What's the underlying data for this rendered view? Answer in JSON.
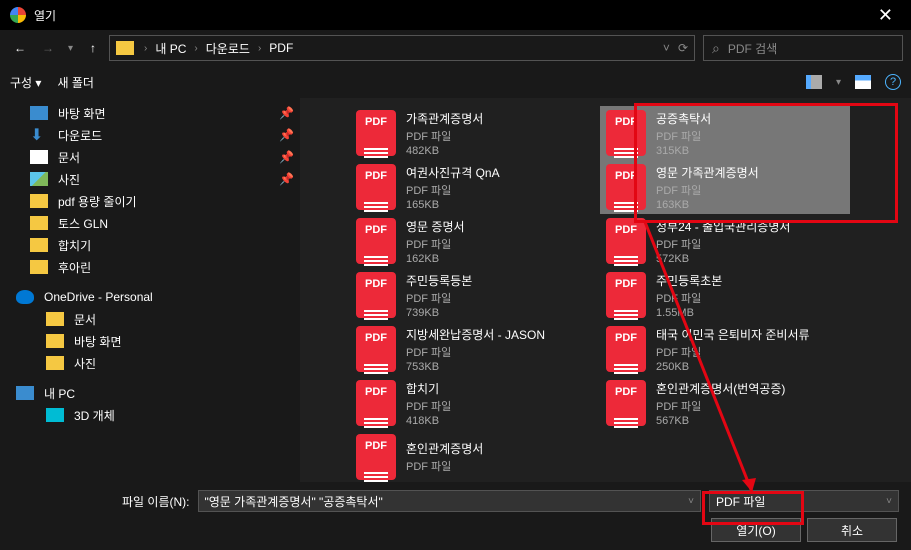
{
  "titlebar": {
    "title": "열기"
  },
  "navbar": {
    "path": [
      "내 PC",
      "다운로드",
      "PDF"
    ],
    "search_placeholder": "PDF 검색"
  },
  "toolbar": {
    "organize": "구성 ▾",
    "new_folder": "새 폴더"
  },
  "sidebar": {
    "quick": [
      {
        "label": "바탕 화면",
        "icon": "desktop",
        "pinned": true
      },
      {
        "label": "다운로드",
        "icon": "download",
        "pinned": true
      },
      {
        "label": "문서",
        "icon": "doc",
        "pinned": true
      },
      {
        "label": "사진",
        "icon": "photo",
        "pinned": true
      },
      {
        "label": "pdf 용량 줄이기",
        "icon": "folder",
        "pinned": false
      },
      {
        "label": "토스 GLN",
        "icon": "folder",
        "pinned": false
      },
      {
        "label": "합치기",
        "icon": "folder",
        "pinned": false
      },
      {
        "label": "후아린",
        "icon": "folder",
        "pinned": false
      }
    ],
    "onedrive": {
      "label": "OneDrive - Personal",
      "children": [
        "문서",
        "바탕 화면",
        "사진"
      ]
    },
    "pc": {
      "label": "내 PC"
    },
    "three_d": {
      "label": "3D 개체"
    }
  },
  "files": {
    "type_label": "PDF 파일",
    "col1": [
      {
        "name": "가족관계증명서",
        "size": "482KB",
        "selected": false
      },
      {
        "name": "여권사진규격 QnA",
        "size": "165KB",
        "selected": false
      },
      {
        "name": "영문 증명서",
        "size": "162KB",
        "selected": false
      },
      {
        "name": "주민등록등본",
        "size": "739KB",
        "selected": false
      },
      {
        "name": "지방세완납증명서 - JASON",
        "size": "753KB",
        "selected": false
      },
      {
        "name": "합치기",
        "size": "418KB",
        "selected": false
      },
      {
        "name": "혼인관계증명서",
        "size": "",
        "selected": false
      }
    ],
    "col2": [
      {
        "name": "공증촉탁서",
        "size": "315KB",
        "selected": true
      },
      {
        "name": "영문 가족관계증명서",
        "size": "163KB",
        "selected": true
      },
      {
        "name": "정부24 - 출입국관리증명서",
        "size": "572KB",
        "selected": false
      },
      {
        "name": "주민등록초본",
        "size": "1.55MB",
        "selected": false
      },
      {
        "name": "태국 이민국 은퇴비자 준비서류",
        "size": "250KB",
        "selected": false
      },
      {
        "name": "혼인관계증명서(번역공증)",
        "size": "567KB",
        "selected": false
      }
    ]
  },
  "bottom": {
    "filename_label": "파일 이름(N):",
    "filename_value": "\"영문 가족관계증명서\" \"공증촉탁서\"",
    "filter": "PDF 파일",
    "open": "열기(O)",
    "cancel": "취소"
  }
}
